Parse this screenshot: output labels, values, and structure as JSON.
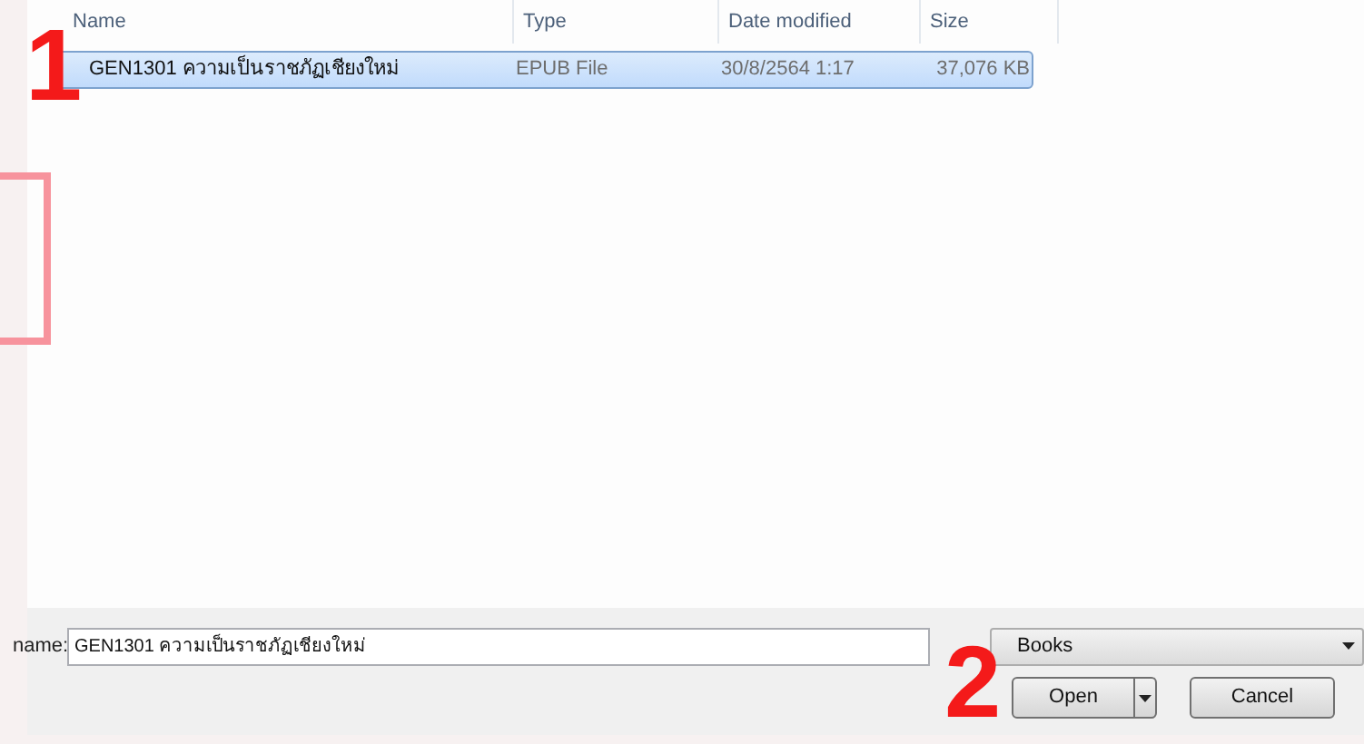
{
  "file_list": {
    "columns": [
      "Name",
      "Type",
      "Date modified",
      "Size"
    ],
    "rows": [
      {
        "name": "GEN1301 ความเป็นราชภัฏเชียงใหม่",
        "type": "EPUB File",
        "date_modified": "30/8/2564 1:17",
        "size": "37,076 KB",
        "selected": true
      }
    ]
  },
  "file_name": {
    "label": "name:",
    "value": "GEN1301 ความเป็นราชภัฏเชียงใหม่"
  },
  "file_type": {
    "value": "Books"
  },
  "buttons": [
    {
      "label": "Open",
      "kind": "split"
    },
    {
      "label": "Cancel",
      "kind": "plain"
    }
  ],
  "annotations": [
    "1",
    "2"
  ]
}
